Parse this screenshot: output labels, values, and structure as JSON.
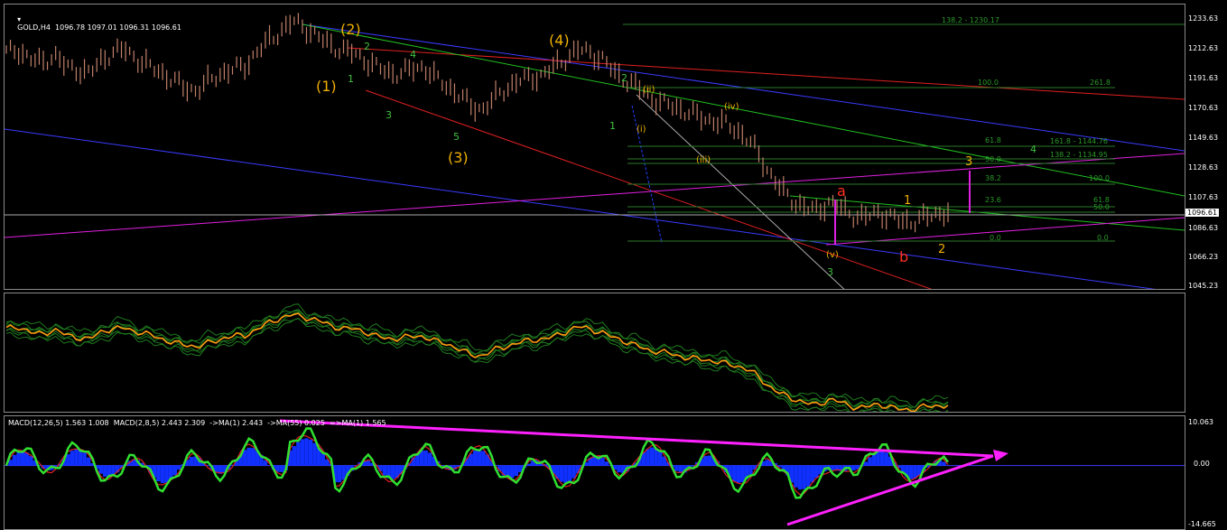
{
  "symbol_header": "GOLD,H4  1096.78 1097.01 1096.31 1096.61",
  "macd_header": "MACD(12,26,5) 1.563 1.008  MACD(2,8,5) 2.443 2.309  ->MA(1) 2.443  ->MA(55) 0.025  =>MA(1) 1.565",
  "current_price": "1096.61",
  "price_axis": [
    "1233.63",
    "1212.63",
    "1191.63",
    "1170.63",
    "1149.63",
    "1128.63",
    "1107.63",
    "1086.63",
    "1066.23",
    "1045.23"
  ],
  "macd_axis": [
    "10.063",
    "0.00",
    "-14.665"
  ],
  "wave_labels": {
    "major": [
      "(1)",
      "(2)",
      "(3)",
      "(4)"
    ],
    "minor_green": [
      "1",
      "2",
      "3",
      "4",
      "5"
    ],
    "wave2_green": [
      "1",
      "2",
      "3",
      "4"
    ],
    "roman": [
      "(i)",
      "(ii)",
      "(iii)",
      "(iv)",
      "(v)"
    ],
    "ab": [
      "a",
      "b"
    ],
    "yellow_count": [
      "1",
      "2",
      "3"
    ]
  },
  "fib_labels": {
    "top": "138.2 - 1230.17",
    "f100": "100.0",
    "f261": "261.8",
    "f618a": "61.8",
    "f1618": "161.8 - 1144.76",
    "f50a": "50.0",
    "f1382": "138.2 - 1134.95",
    "f382": "38.2",
    "f100b": "100.0",
    "f236": "23.6",
    "f618b": "61.8",
    "f50b": "50.0",
    "f0a": "0.0",
    "f0b": "0.0"
  },
  "chart_data": {
    "type": "line",
    "title": "GOLD,H4",
    "instrument": "GOLD",
    "timeframe": "H4",
    "ohlc_last": {
      "open": 1096.78,
      "high": 1097.01,
      "low": 1096.31,
      "close": 1096.61
    },
    "ylim": [
      1045.23,
      1233.63
    ],
    "close_series_approx": [
      1210,
      1212,
      1205,
      1203,
      1208,
      1200,
      1198,
      1195,
      1205,
      1210,
      1212,
      1205,
      1200,
      1196,
      1190,
      1185,
      1183,
      1190,
      1195,
      1198,
      1200,
      1210,
      1218,
      1225,
      1232,
      1228,
      1222,
      1216,
      1212,
      1210,
      1205,
      1200,
      1196,
      1195,
      1198,
      1200,
      1192,
      1186,
      1180,
      1172,
      1170,
      1178,
      1185,
      1190,
      1192,
      1194,
      1200,
      1206,
      1212,
      1210,
      1205,
      1196,
      1190,
      1185,
      1178,
      1174,
      1172,
      1168,
      1165,
      1162,
      1160,
      1157,
      1150,
      1140,
      1125,
      1113,
      1105,
      1100,
      1098,
      1104,
      1100,
      1095,
      1093,
      1097,
      1094,
      1091,
      1090,
      1093,
      1096,
      1097
    ],
    "macd_ylim": [
      -14.665,
      10.063
    ],
    "fib_levels": [
      {
        "label": "138.2 - 1230.17",
        "value": 1230.17
      },
      {
        "label": "161.8 - 1144.76",
        "value": 1144.76
      },
      {
        "label": "138.2 - 1134.95",
        "value": 1134.95
      }
    ]
  }
}
